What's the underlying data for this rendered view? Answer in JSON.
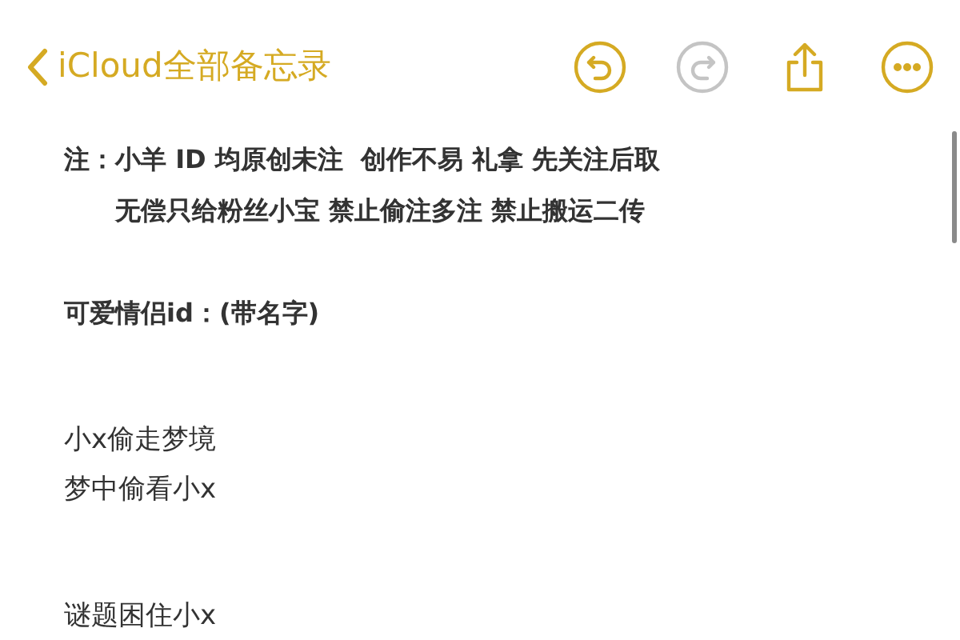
{
  "nav": {
    "back_label": "iCloud全部备忘录",
    "actions": [
      {
        "kind": "undo",
        "disabled": false
      },
      {
        "kind": "redo",
        "disabled": true
      },
      {
        "kind": "share",
        "disabled": false
      },
      {
        "kind": "more",
        "disabled": false
      }
    ]
  },
  "note": {
    "prefix": "注：",
    "lines": [
      "小羊 ID 均原创未注  创作不易 礼拿 先关注后取",
      "无偿只给粉丝小宝 禁止偷注多注 禁止搬运二传"
    ]
  },
  "body": [
    {
      "kind": "heading",
      "text": "可爱情侣id：(带名字)"
    },
    {
      "kind": "gap"
    },
    {
      "kind": "line",
      "text": "小x偷走梦境"
    },
    {
      "kind": "line",
      "text": "梦中偷看小x"
    },
    {
      "kind": "gap"
    },
    {
      "kind": "line",
      "text": "谜题困住小x"
    }
  ]
}
